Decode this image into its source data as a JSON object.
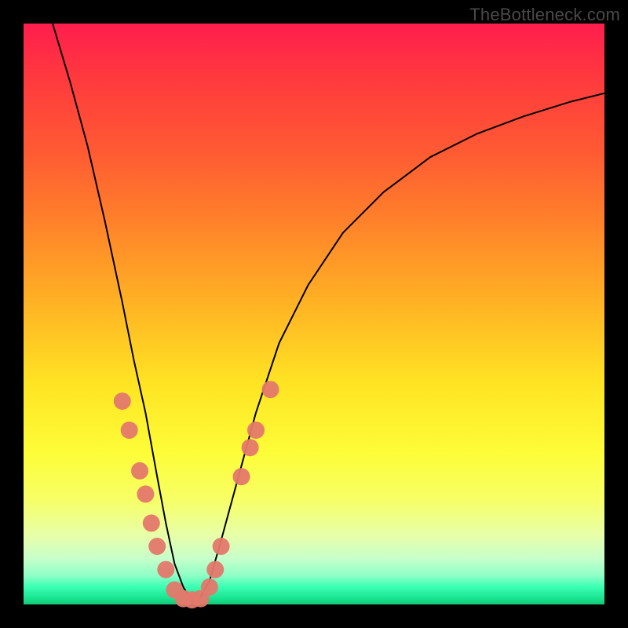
{
  "watermark": "TheBottleneck.com",
  "chart_data": {
    "type": "line",
    "title": "",
    "xlabel": "",
    "ylabel": "",
    "xlim": [
      0,
      100
    ],
    "ylim": [
      0,
      100
    ],
    "grid": false,
    "series": [
      {
        "name": "bottleneck-curve",
        "color": "#000000",
        "x": [
          5,
          8,
          11,
          14,
          17,
          19,
          21,
          23,
          24.5,
          26,
          27.5,
          29,
          30,
          32,
          34,
          37,
          40,
          44,
          49,
          55,
          62,
          70,
          78,
          86,
          94,
          100
        ],
        "y": [
          100,
          90,
          79,
          66,
          52,
          42,
          33,
          22,
          14,
          7,
          3,
          0.5,
          0.5,
          4,
          11,
          22,
          33,
          45,
          55,
          64,
          71,
          77,
          81,
          84,
          86.5,
          88
        ]
      }
    ],
    "scatter_points": {
      "name": "highlighted-points",
      "color": "#e4786c",
      "points": [
        {
          "x": 17.0,
          "y": 35
        },
        {
          "x": 18.2,
          "y": 30
        },
        {
          "x": 20.0,
          "y": 23
        },
        {
          "x": 21.0,
          "y": 19
        },
        {
          "x": 22.0,
          "y": 14
        },
        {
          "x": 23.0,
          "y": 10
        },
        {
          "x": 24.5,
          "y": 6
        },
        {
          "x": 26.0,
          "y": 2.5
        },
        {
          "x": 27.5,
          "y": 1.0
        },
        {
          "x": 29.0,
          "y": 0.8
        },
        {
          "x": 30.5,
          "y": 1.0
        },
        {
          "x": 32.0,
          "y": 3.0
        },
        {
          "x": 33.0,
          "y": 6
        },
        {
          "x": 34.0,
          "y": 10
        },
        {
          "x": 37.5,
          "y": 22
        },
        {
          "x": 39.0,
          "y": 27
        },
        {
          "x": 40.0,
          "y": 30
        },
        {
          "x": 42.5,
          "y": 37
        }
      ]
    },
    "background_gradient": {
      "0": "#ff1d4d",
      "50": "#ffe423",
      "100": "#14c877"
    }
  }
}
